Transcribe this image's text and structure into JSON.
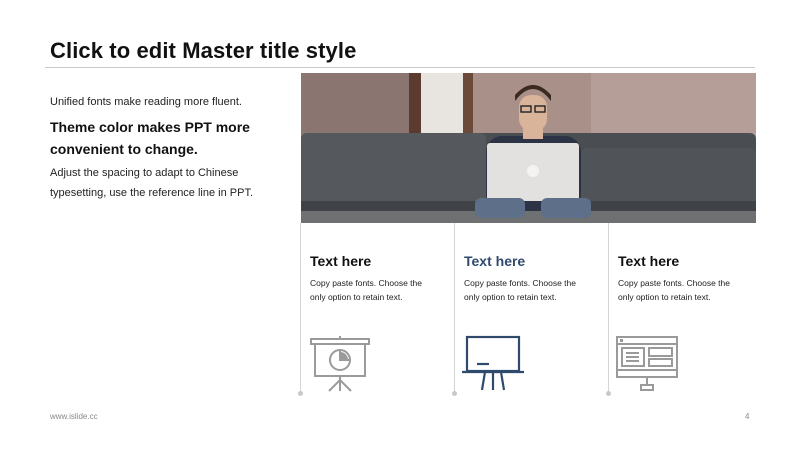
{
  "slide": {
    "title": "Click to edit Master title style",
    "body_lines": [
      "Unified fonts make reading more fluent.",
      "Theme color makes PPT more",
      "convenient to change.",
      "Adjust the spacing to adapt to Chinese",
      "typesetting, use the reference line in PPT."
    ],
    "columns": [
      {
        "heading": "Text here",
        "desc_line1": "Copy paste fonts. Choose the",
        "desc_line2": "only option to retain text.",
        "icon": "presentation-pie-chart-icon"
      },
      {
        "heading": "Text here",
        "desc_line1": "Copy paste fonts. Choose the",
        "desc_line2": "only option to retain text.",
        "icon": "blackboard-icon"
      },
      {
        "heading": "Text here",
        "desc_line1": "Copy paste fonts. Choose the",
        "desc_line2": "only option to retain text.",
        "icon": "desktop-monitor-icon"
      }
    ],
    "footer_url": "www.islide.cc",
    "page_number": "4"
  },
  "colors": {
    "accent": "#2f4a6d",
    "icon_gray": "#9a9a9a",
    "rule": "#c8c8c8"
  }
}
